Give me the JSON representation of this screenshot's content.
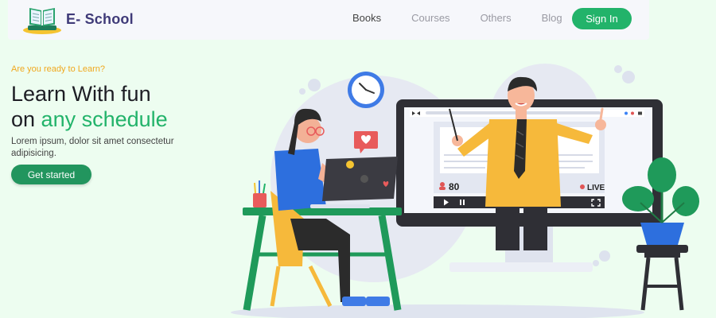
{
  "brand": {
    "name": "E- School"
  },
  "nav": {
    "items": [
      {
        "label": "Books",
        "active": true
      },
      {
        "label": "Courses",
        "active": false
      },
      {
        "label": "Others",
        "active": false
      },
      {
        "label": "Blog",
        "active": false
      }
    ],
    "signin_label": "Sign In"
  },
  "hero": {
    "eyebrow": "Are you ready to Learn?",
    "headline_line1": "Learn With fun",
    "headline_line2_prefix": "on ",
    "headline_line2_accent": "any schedule",
    "description": "Lorem ipsum, dolor sit amet consectetur adipisicing.",
    "cta_label": "Get started"
  },
  "illustration": {
    "viewer_count": "80",
    "live_label": "LIVE"
  },
  "colors": {
    "accent_green": "#22b36a",
    "eyebrow_orange": "#f0a81e",
    "brand_purple": "#3f3a78",
    "background": "#edfdf0"
  },
  "icons": [
    "book-logo-icon",
    "play-icon",
    "pause-icon",
    "fullscreen-icon",
    "clock-icon",
    "heart-icon",
    "user-icon"
  ]
}
